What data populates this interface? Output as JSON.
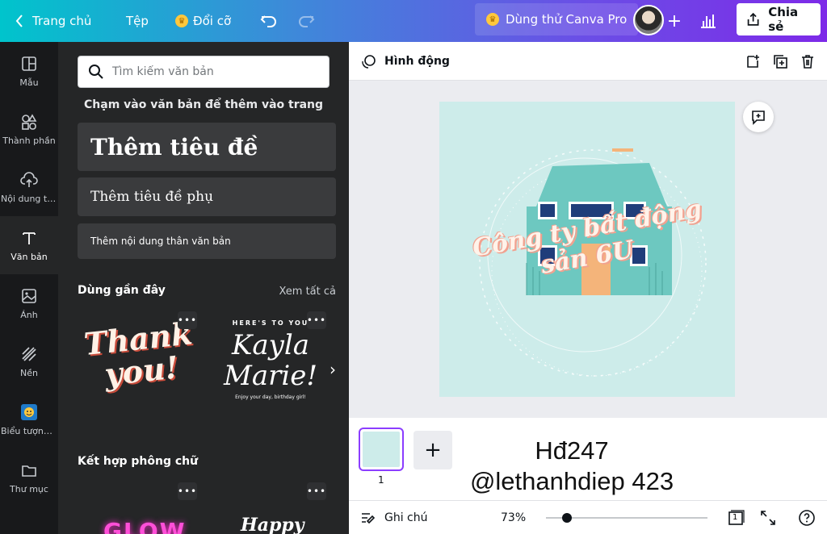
{
  "topbar": {
    "home_label": "Trang chủ",
    "file_label": "Tệp",
    "resize_label": "Đổi cỡ",
    "try_pro_label": "Dùng thử Canva Pro",
    "share_label": "Chia sẻ"
  },
  "rail": {
    "items": [
      {
        "label": "Mẫu",
        "icon": "template-icon"
      },
      {
        "label": "Thành phần",
        "icon": "elements-icon"
      },
      {
        "label": "Nội dung tải lên",
        "icon": "upload-icon"
      },
      {
        "label": "Văn bản",
        "icon": "text-icon"
      },
      {
        "label": "Ảnh",
        "icon": "photo-icon"
      },
      {
        "label": "Nền",
        "icon": "background-icon"
      },
      {
        "label": "Biểu tượng cảm xúc",
        "icon": "emoji-icon"
      },
      {
        "label": "Thư mục",
        "icon": "folder-icon"
      }
    ],
    "active_index": 3
  },
  "panel": {
    "search_placeholder": "Tìm kiếm văn bản",
    "hint": "Chạm vào văn bản để thêm vào trang",
    "add_title": "Thêm tiêu đề",
    "add_subtitle": "Thêm tiêu đề phụ",
    "add_body": "Thêm nội dung thân văn bản",
    "recent_title": "Dùng gần đây",
    "see_all": "Xem tất cả",
    "thumb1_text": "Thank you!",
    "thumb2_top": "HERE'S TO YOU",
    "thumb2_main": "Kayla Marie!",
    "thumb2_bottom": "Enjoy your day, birthday girl!",
    "font_combo_title": "Kết hợp phông chữ",
    "thumb3_text": "GLOW",
    "thumb4_text": "Happy"
  },
  "context_bar": {
    "animate_label": "Hình động"
  },
  "design": {
    "line1": "Công ty bất động",
    "line2": "sản 6U",
    "background": "#cdecea"
  },
  "pages": {
    "page_number": "1",
    "watermark_line1": "Hđ247",
    "watermark_line2": "@lethanhdiep 423"
  },
  "statusbar": {
    "notes_label": "Ghi chú",
    "zoom_label": "73%",
    "zoom_percent": 73,
    "page_count": "1"
  },
  "colors": {
    "accent": "#8b3dff",
    "panel_bg": "#252627",
    "rail_bg": "#18191b"
  }
}
